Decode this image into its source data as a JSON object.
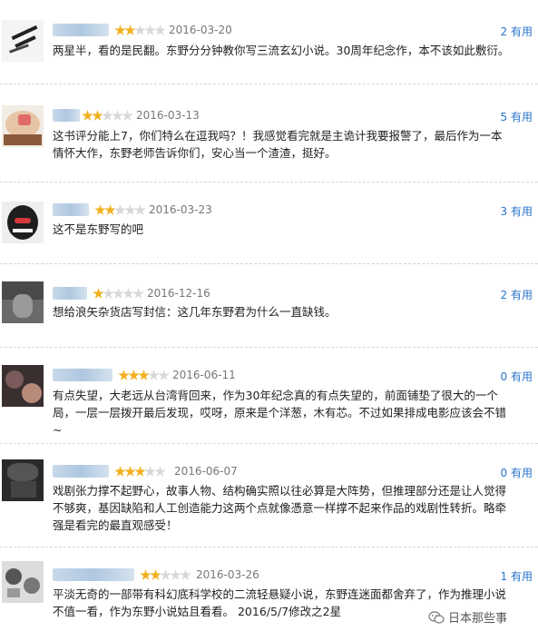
{
  "reviews": [
    {
      "stars": 2,
      "date": "2016-03-20",
      "useful": "2 有用",
      "text": "两星半，看的是民翻。东野分分钟教你写三流玄幻小说。30周年纪念作，本不该如此敷衍。"
    },
    {
      "stars": 2,
      "date": "2016-03-13",
      "useful": "5 有用",
      "text": "这书评分能上7，你们特么在逗我吗？！我感觉看完就是主诡计我要报警了，最后作为一本情怀大作，东野老师告诉你们，安心当一个渣渣，挺好。"
    },
    {
      "stars": 2,
      "date": "2016-03-23",
      "useful": "3 有用",
      "text": "这不是东野写的吧"
    },
    {
      "stars": 1,
      "date": "2016-12-16",
      "useful": "2 有用",
      "text": "想给浪矢杂货店写封信：这几年东野君为什么一直缺钱。"
    },
    {
      "stars": 3,
      "date": "2016-06-11",
      "useful": "0 有用",
      "text": "有点失望，大老远从台湾背回来，作为30年纪念真的有点失望的，前面铺垫了很大的一个局，一层一层拨开最后发现，哎呀，原来是个洋葱，木有芯。不过如果排成电影应该会不错~"
    },
    {
      "stars": 3,
      "date": "2016-06-07",
      "useful": "0 有用",
      "text": "戏剧张力撑不起野心，故事人物、结构确实照以往必算是大阵势，但推理部分还是让人觉得不够爽，基因缺陷和人工创造能力这两个点就像憑意一样撑不起来作品的戏剧性转折。略牵强是看完的最直观感受！"
    },
    {
      "stars": 2,
      "date": "2016-03-26",
      "useful": "1 有用",
      "text": "平淡无奇的一部带有科幻底科学校的二流轻悬疑小说，东野连迷面都舍弃了，作为推理小说不值一看，作为东野小说姑且看看。 2016/5/7修改之2星"
    }
  ],
  "watermark": "日本那些事",
  "watermark_icon": "wechat-icon"
}
